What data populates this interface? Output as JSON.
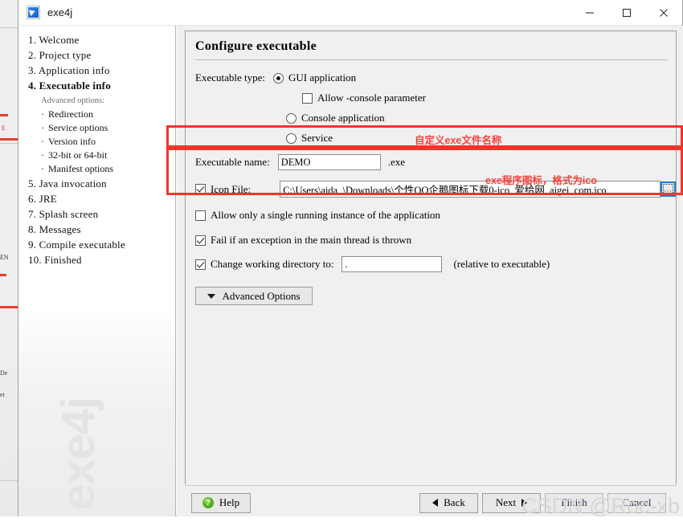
{
  "window": {
    "title": "exe4j",
    "app_icon": "exe4j-logo-icon",
    "minimize_label": "Minimize",
    "maximize_label": "Maximize",
    "close_label": "Close"
  },
  "nav": {
    "items": [
      {
        "label": "1. Welcome",
        "current": false
      },
      {
        "label": "2. Project type",
        "current": false
      },
      {
        "label": "3. Application info",
        "current": false
      },
      {
        "label": "4. Executable info",
        "current": true
      }
    ],
    "group_label": "Advanced options:",
    "sub_items": [
      {
        "label": "Redirection"
      },
      {
        "label": "Service options"
      },
      {
        "label": "Version info"
      },
      {
        "label": "32-bit or 64-bit"
      },
      {
        "label": "Manifest options"
      }
    ],
    "items_after": [
      {
        "label": "5. Java invocation"
      },
      {
        "label": "6. JRE"
      },
      {
        "label": "7. Splash screen"
      },
      {
        "label": "8. Messages"
      },
      {
        "label": "9. Compile executable"
      },
      {
        "label": "10. Finished"
      }
    ],
    "watermark": "exe4j"
  },
  "panel": {
    "heading": "Configure executable",
    "executable_type": {
      "label": "Executable type:",
      "options": [
        {
          "label": "GUI application",
          "selected": true
        },
        {
          "label": "Console application",
          "selected": false
        },
        {
          "label": "Service",
          "selected": false
        }
      ],
      "allow_console": {
        "label": "Allow -console parameter",
        "checked": false
      }
    },
    "executable_name": {
      "label": "Executable name:",
      "value": "DEMO",
      "placeholder": "",
      "suffix": ".exe"
    },
    "icon_file": {
      "label": "Icon File:",
      "checked": true,
      "value": "C:\\Users\\aida_\\Downloads\\个性QQ企鹅图标下载0-ico_爱给网_aigei_com.ico",
      "placeholder": "",
      "browse_label": "..."
    },
    "single_instance": {
      "label": "Allow only a single running instance of the application",
      "checked": false
    },
    "fail_on_exception": {
      "label": "Fail if an exception in the main thread is thrown",
      "checked": true
    },
    "working_directory": {
      "label": "Change working directory to:",
      "checked": true,
      "value": ".",
      "hint": "(relative to executable)"
    },
    "advanced_options_button": "Advanced Options"
  },
  "annotations": {
    "accent_color": "#f4433c",
    "note_executable_name": "自定义exe文件名称",
    "note_icon_file": "exe程序图标，格式为ico"
  },
  "footer": {
    "help": "Help",
    "back": "Back",
    "next": "Next",
    "finish": "Finish",
    "cancel": "Cancel"
  },
  "watermark": {
    "csdn": "CSDN @Roc-xb"
  }
}
